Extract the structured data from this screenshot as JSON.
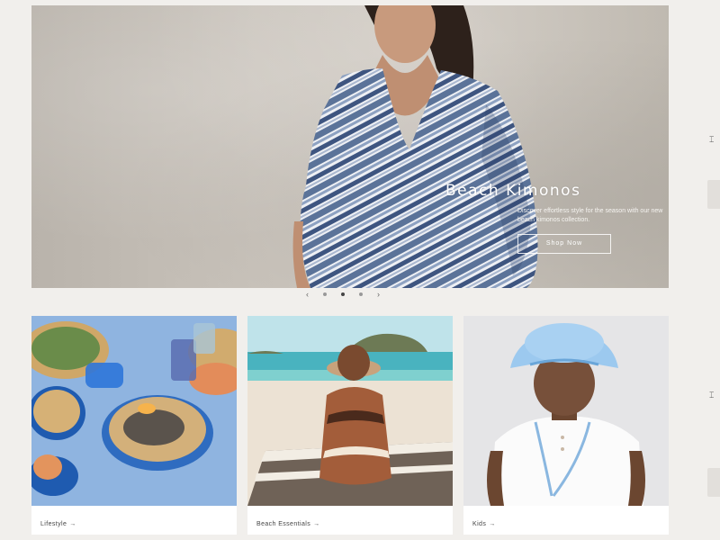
{
  "hero": {
    "title": "Beach Kimonos",
    "subtitle": "Discover effortless style for the season with our new beach kimonos collection.",
    "cta_label": "Shop Now"
  },
  "slider": {
    "prev": "‹",
    "next": "›",
    "slides": 3,
    "active_index": 1
  },
  "cards": [
    {
      "label": "Lifestyle",
      "arrow": "→"
    },
    {
      "label": "Beach Essentials",
      "arrow": "→"
    },
    {
      "label": "Kids",
      "arrow": "→"
    }
  ],
  "edge": {
    "mark_top": "⌶",
    "mark_bottom": "⌶"
  }
}
